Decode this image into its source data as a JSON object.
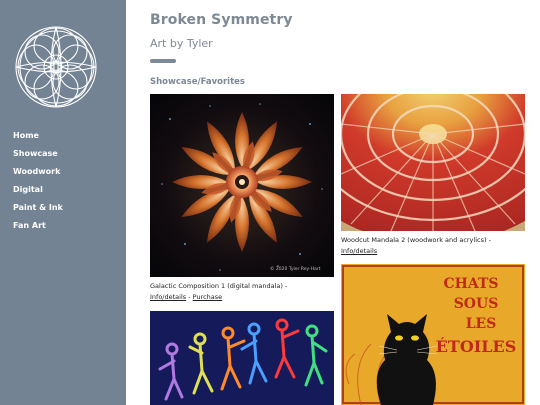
{
  "sidebar": {
    "logo_icon": "interlaced-circles-logo",
    "nav": [
      "Home",
      "Showcase",
      "Woodwork",
      "Digital",
      "Paint & Ink",
      "Fan Art"
    ]
  },
  "header": {
    "title": "Broken Symmetry",
    "subtitle": "Art by Tyler"
  },
  "section": {
    "heading": "Showcase/Favorites"
  },
  "gallery": {
    "galactic": {
      "caption": "Galactic Composition 1 (digital mandala) -",
      "info_link": "Info/details",
      "separator": " - ",
      "purchase_link": "Purchase",
      "watermark": "© 2020 Tyler Rey-Hart"
    },
    "woodcut": {
      "caption": "Woodcut Mandala 2 (woodwork and acrylics) -",
      "info_link": "Info/details"
    },
    "chats": {
      "poster_line1": "CHATS",
      "poster_line2": "SOUS",
      "poster_line3": "LES",
      "poster_line4": "ÉTOILES"
    }
  },
  "colors": {
    "sidebar_bg": "#748394",
    "heading_text": "#7d8995",
    "nav_text": "#ffffff"
  }
}
